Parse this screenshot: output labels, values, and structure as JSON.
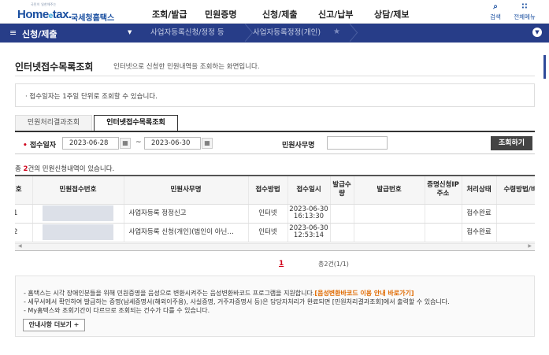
{
  "header": {
    "logo_tiny": "국민이 일한해주는",
    "logo_home": "Home",
    "logo_e": "e",
    "logo_tax": "tax.",
    "logo_brand": "국세청홈택스",
    "nav": [
      "조회/발급",
      "민원증명",
      "신청/제출",
      "신고/납부",
      "상담/제보"
    ],
    "search_label": "검색",
    "menu_label": "전체메뉴"
  },
  "navbar": {
    "current": "신청/제출",
    "crumb1": "사업자등록신청/정정 등",
    "crumb2": "사업자등록정정(개인)"
  },
  "page": {
    "title": "인터넷접수목록조회",
    "desc": "인터넷으로 신청한 민원내역을 조회하는 화면입니다.",
    "info": "· 접수일자는 1주일 단위로 조회할 수 있습니다."
  },
  "tabs": [
    {
      "label": "민원처리결과조회",
      "active": false
    },
    {
      "label": "인터넷접수목록조회",
      "active": true
    }
  ],
  "search": {
    "date_label": "접수일자",
    "date_from": "2023-06-28",
    "date_to": "2023-06-30",
    "tilde": "~",
    "affair_label": "민원사무명",
    "affair_value": "",
    "button": "조회하기"
  },
  "count": {
    "prefix": "총 ",
    "num": "2",
    "suffix": "건의 민원신청내역이 있습니다."
  },
  "table": {
    "headers": [
      "번호",
      "민원접수번호",
      "민원사무명",
      "접수방법",
      "접수일시",
      "발급수량",
      "발급번호",
      "증명신청IP주소",
      "처리상태",
      "수령방법/비고"
    ],
    "rows": [
      {
        "no": "1",
        "affair": "사업자등록 정정신고",
        "method": "인터넷",
        "date": "2023-06-30",
        "time": "16:13:30",
        "status": "접수완료"
      },
      {
        "no": "2",
        "affair": "사업자등록 신청(개인)(법인이 아닌…",
        "method": "인터넷",
        "date": "2023-06-30",
        "time": "12:53:14",
        "status": "접수완료"
      }
    ]
  },
  "paging": {
    "current": "1",
    "total": "총2건(1/1)"
  },
  "notice": {
    "line1": "- 홈택스는 시각 장애인분들을 위해 민원증명을 음성으로 변환시켜주는 음성변환바코드 프로그램을 지원합니다.",
    "line1_link": "[음성변환바코드 이용 안내 바로가기]",
    "line2": "- 세무서에서 확인하여 발급하는 증명(납세증명서(해외이주용), 사실증명, 거주자증명서 등)은 담당자처리가 완료되면 [민원처리결과조회]에서 출력할 수 있습니다.",
    "line3": "- My홈택스와 조회기간이 다르므로 조회되는 건수가 다를 수 있습니다.",
    "more_button": "안내사항 더보기 +"
  }
}
